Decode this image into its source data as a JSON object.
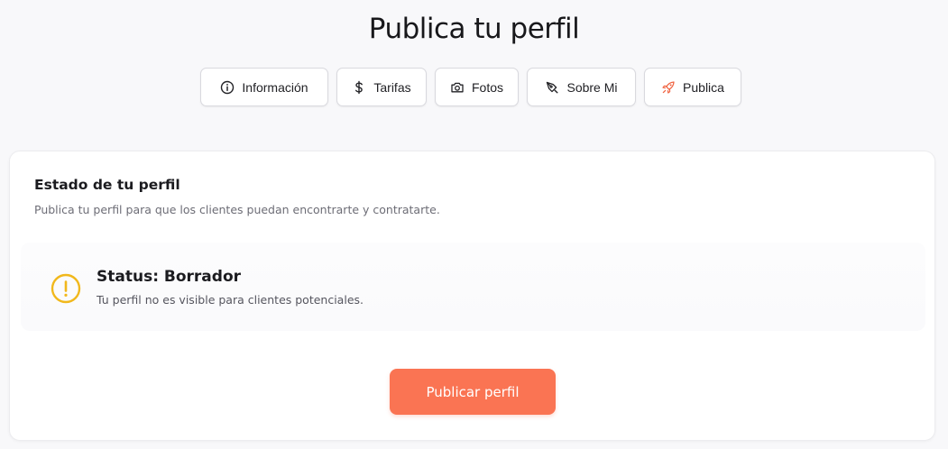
{
  "page": {
    "title": "Publica tu perfil"
  },
  "tabs": [
    {
      "label": "Información",
      "icon": "info-circle-icon"
    },
    {
      "label": "Tarifas",
      "icon": "dollar-icon"
    },
    {
      "label": "Fotos",
      "icon": "camera-icon"
    },
    {
      "label": "Sobre Mi",
      "icon": "pen-nib-icon"
    },
    {
      "label": "Publica",
      "icon": "rocket-icon"
    }
  ],
  "card": {
    "title": "Estado de tu perfil",
    "subtitle": "Publica tu perfil para que los clientes puedan encontrarte y contratarte."
  },
  "status": {
    "heading": "Status: Borrador",
    "description": "Tu perfil no es visible para clientes potenciales.",
    "icon": "alert-circle-icon"
  },
  "actions": {
    "publish_label": "Publicar perfil"
  },
  "colors": {
    "accent": "#fa7453",
    "warning": "#f1b81c",
    "rocket": "#f06543"
  }
}
